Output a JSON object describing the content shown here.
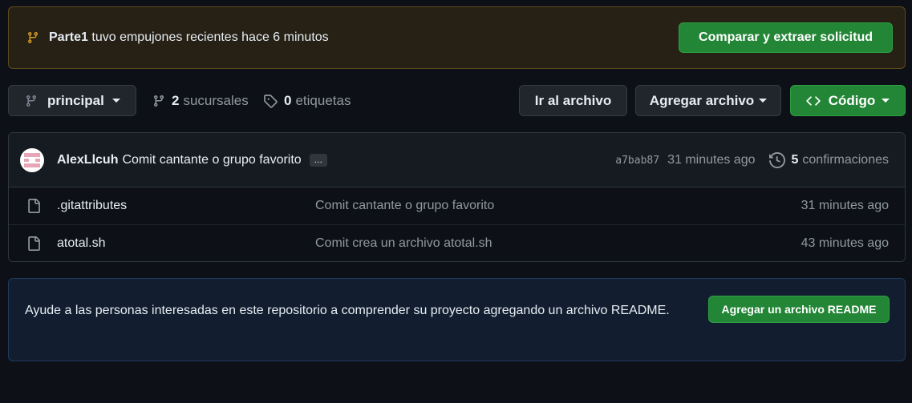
{
  "banner": {
    "branch_name": "Parte1",
    "message": "tuvo empujones recientes hace 6 minutos",
    "compare_button": "Comparar y extraer solicitud"
  },
  "toolbar": {
    "branch_selector": "principal",
    "branches_count": "2",
    "branches_label": "sucursales",
    "tags_count": "0",
    "tags_label": "etiquetas",
    "goto_file": "Ir al archivo",
    "add_file": "Agregar archivo",
    "code": "Código"
  },
  "latest_commit": {
    "author": "AlexLlcuh",
    "message": "Comit cantante o grupo favorito",
    "ellipsis": "…",
    "sha": "a7bab87",
    "time": "31 minutes ago",
    "commits_count": "5",
    "commits_label": "confirmaciones"
  },
  "files": [
    {
      "name": ".gitattributes",
      "commit": "Comit cantante o grupo favorito",
      "time": "31 minutes ago"
    },
    {
      "name": "atotal.sh",
      "commit": "Comit crea un archivo atotal.sh",
      "time": "43 minutes ago"
    }
  ],
  "readme_prompt": {
    "text": "Ayude a las personas interesadas en este repositorio a comprender su proyecto agregando un archivo README.",
    "button": "Agregar un archivo README"
  },
  "colors": {
    "background": "#0d1117",
    "accent_green": "#238636",
    "banner_icon": "#d29922",
    "muted_text": "#9198a1"
  }
}
